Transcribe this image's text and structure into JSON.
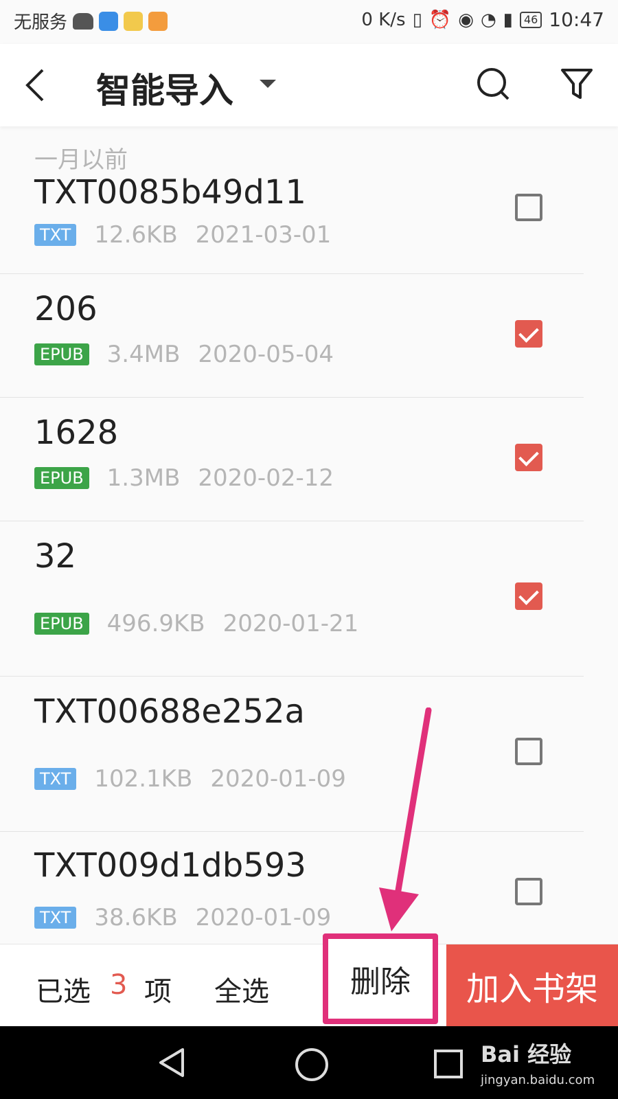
{
  "status_bar": {
    "carrier": "无服务",
    "net_speed": "0 K/s",
    "battery": "46",
    "time": "10:47"
  },
  "header": {
    "title": "智能导入"
  },
  "list": {
    "section_label": "一月以前",
    "items": [
      {
        "name": "TXT0085b49d11",
        "type": "TXT",
        "size": "12.6KB",
        "date": "2021-03-01",
        "checked": false
      },
      {
        "name": "206",
        "type": "EPUB",
        "size": "3.4MB",
        "date": "2020-05-04",
        "checked": true
      },
      {
        "name": "1628",
        "type": "EPUB",
        "size": "1.3MB",
        "date": "2020-02-12",
        "checked": true
      },
      {
        "name": "32",
        "type": "EPUB",
        "size": "496.9KB",
        "date": "2020-01-21",
        "checked": true
      },
      {
        "name": "TXT00688e252a",
        "type": "TXT",
        "size": "102.1KB",
        "date": "2020-01-09",
        "checked": false
      },
      {
        "name": "TXT009d1db593",
        "type": "TXT",
        "size": "38.6KB",
        "date": "2020-01-09",
        "checked": false
      }
    ]
  },
  "bottom_bar": {
    "selected_prefix": "已选",
    "selected_count": "3",
    "selected_suffix": "项",
    "select_all": "全选",
    "delete": "删除",
    "add_to_shelf": "加入书架"
  },
  "watermark": {
    "brand": "Bai 经验",
    "url": "jingyan.baidu.com"
  },
  "colors": {
    "accent": "#e9554b",
    "checkbox_checked": "#e25a50",
    "highlight_box": "#e0307a",
    "badge_txt": "#6aaeea",
    "badge_epub": "#3ca448"
  }
}
